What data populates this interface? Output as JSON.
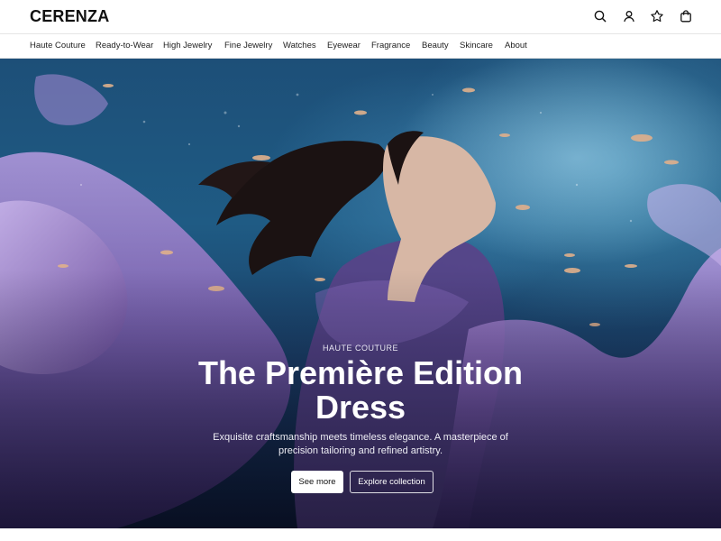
{
  "brand": {
    "logo_text": "CERENZA"
  },
  "header_icons": [
    "search-icon",
    "user-icon",
    "star-icon",
    "shopping-bag-icon"
  ],
  "nav": {
    "items": [
      {
        "label": "Haute Couture"
      },
      {
        "label": "Ready-to-Wear"
      },
      {
        "label": "High Jewelry"
      },
      {
        "label": "Fine Jewelry"
      },
      {
        "label": "Watches"
      },
      {
        "label": "Eyewear"
      },
      {
        "label": "Fragrance"
      },
      {
        "label": "Beauty"
      },
      {
        "label": "Skincare"
      },
      {
        "label": "About"
      }
    ]
  },
  "hero": {
    "eyebrow": "HAUTE COUTURE",
    "title_line1": "The Première Edition",
    "title_line2": "Dress",
    "subtitle": "Exquisite craftsmanship meets timeless elegance. A masterpiece of precision tailoring and refined artistry.",
    "primary_button": "See more",
    "secondary_button": "Explore collection"
  },
  "colors": {
    "accent_text": "#111111",
    "hero_water_top": "#1d4f78",
    "hero_water_bottom": "#0c1a33",
    "fabric": "#7a5aa8"
  }
}
